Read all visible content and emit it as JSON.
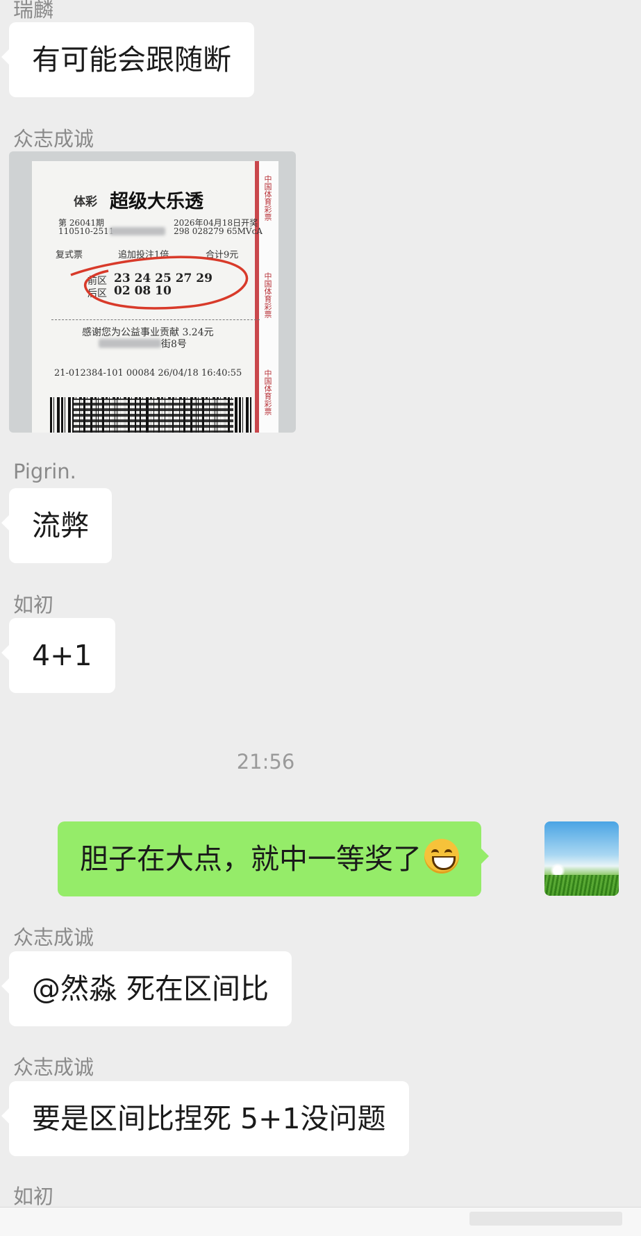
{
  "chat": {
    "messages": [
      {
        "sender": "瑞麟",
        "text": "有可能会跟随断"
      },
      {
        "sender": "众志成诚",
        "type": "image"
      },
      {
        "sender": "Pigrin.",
        "text": "流弊"
      },
      {
        "sender": "如初",
        "text": "4+1"
      },
      {
        "timestamp": "21:56"
      },
      {
        "sender": "me",
        "text": "胆子在大点，就中一等奖了",
        "emoji": "grinning-face-emoji"
      },
      {
        "sender": "众志成诚",
        "text": "@然淼  死在区间比"
      },
      {
        "sender": "众志成诚",
        "text": "要是区间比捏死 5+1没问题"
      },
      {
        "sender": "如初"
      }
    ]
  },
  "ticket": {
    "brand_small": "体彩",
    "brand_big": "超级大乐透",
    "issue": "第 26041期",
    "code": "110510-2511",
    "draw_date": "2026年04月18日开奖",
    "serial": "298 028279  65MVcA",
    "type": "复式票",
    "multiple": "追加投注1倍",
    "total": "合计9元",
    "front_label": "前区",
    "front_numbers": "23  24  25  27  29",
    "back_label": "后区",
    "back_numbers": "02  08  10",
    "thanks": "感谢您为公益事业贡献 3.24元",
    "address": "街8号",
    "footer": "21-012384-101   00084   26/04/18  16:40:55",
    "side_text": "中国体育彩票"
  },
  "colors": {
    "background": "#ededed",
    "bubble_left": "#ffffff",
    "bubble_right": "#95ec69",
    "sender_name": "#8a8a8a",
    "ticket_red": "#c9474c"
  }
}
